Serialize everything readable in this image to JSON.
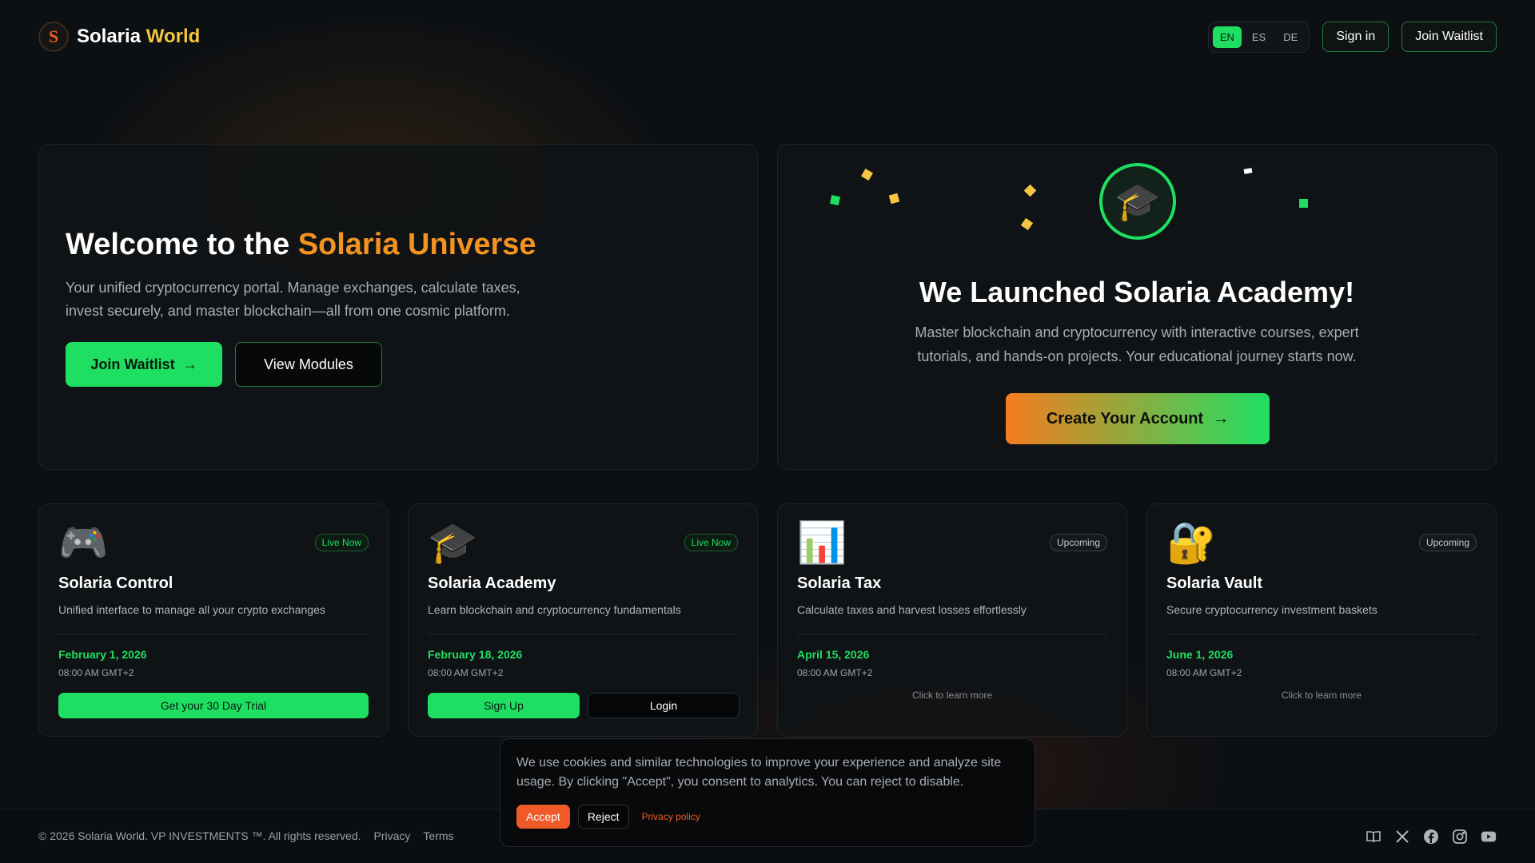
{
  "header": {
    "logo_letter": "S",
    "brand_main": "Solaria",
    "brand_accent": "World",
    "languages": [
      "EN",
      "ES",
      "DE"
    ],
    "active_language": "EN",
    "sign_in": "Sign in",
    "join_waitlist": "Join Waitlist"
  },
  "hero_left": {
    "title_plain": "Welcome to the",
    "title_highlight": "Solaria Universe",
    "subtitle": "Your unified cryptocurrency portal. Manage exchanges, calculate taxes, invest securely, and master blockchain—all from one cosmic platform.",
    "primary_button": "Join Waitlist",
    "primary_arrow": "→",
    "secondary_button": "View Modules"
  },
  "hero_right": {
    "icon": "graduation-cap-icon",
    "title": "We Launched Solaria Academy!",
    "subtitle": "Master blockchain and cryptocurrency with interactive courses, expert tutorials, and hands-on projects. Your educational journey starts now.",
    "button": "Create Your Account",
    "button_arrow": "→"
  },
  "modules": [
    {
      "icon": "game-controller-icon",
      "badge": "Live Now",
      "title": "Solaria Control",
      "description": "Unified interface to manage all your crypto exchanges",
      "date": "February 1, 2026",
      "time": "08:00 AM GMT+2",
      "button": "Get your 30 Day Trial"
    },
    {
      "icon": "graduation-cap-icon",
      "badge": "Live Now",
      "title": "Solaria Academy",
      "description": "Learn blockchain and cryptocurrency fundamentals",
      "date": "February 18, 2026",
      "time": "08:00 AM GMT+2",
      "button_primary": "Sign Up",
      "button_secondary": "Login"
    },
    {
      "icon": "bar-chart-icon",
      "badge": "Upcoming",
      "title": "Solaria Tax",
      "description": "Calculate taxes and harvest losses effortlessly",
      "date": "April 15, 2026",
      "time": "08:00 AM GMT+2",
      "learn_more": "Click to learn more"
    },
    {
      "icon": "lock-key-icon",
      "badge": "Upcoming",
      "title": "Solaria Vault",
      "description": "Secure cryptocurrency investment baskets",
      "date": "June 1, 2026",
      "time": "08:00 AM GMT+2",
      "learn_more": "Click to learn more"
    }
  ],
  "cookie": {
    "text": "We use cookies and similar technologies to improve your experience and analyze site usage. By clicking \"Accept\", you consent to analytics. You can reject to disable.",
    "accept": "Accept",
    "reject": "Reject",
    "policy": "Privacy policy"
  },
  "footer": {
    "copyright": "© 2026 Solaria World. VP INVESTMENTS ™. All rights reserved.",
    "privacy": "Privacy",
    "terms": "Terms",
    "social": [
      "book-icon",
      "x-icon",
      "facebook-icon",
      "instagram-icon",
      "youtube-icon"
    ]
  },
  "colors": {
    "green": "#1fdf62",
    "orange": "#f57c1f",
    "gold": "#f5c542",
    "red_orange": "#f05a28",
    "background": "#0d1013"
  }
}
